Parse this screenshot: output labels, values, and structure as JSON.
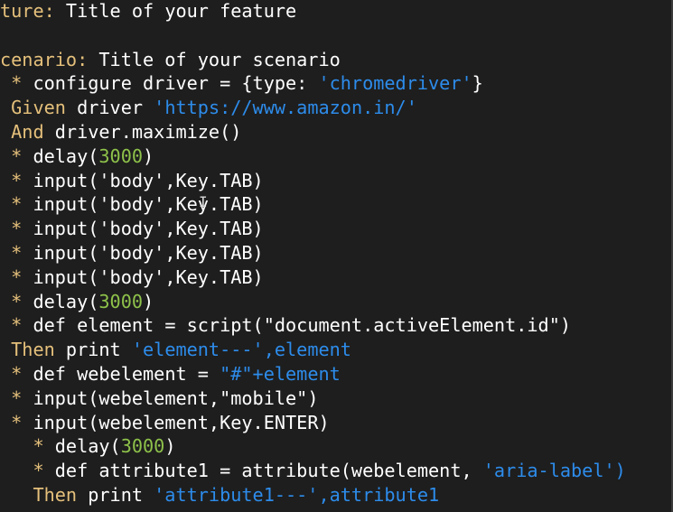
{
  "editor": {
    "lines": [
      {
        "id": "feature",
        "segs": [
          {
            "c": "kw",
            "t": "ture:"
          },
          {
            "c": "plain",
            "t": " Title of your feature"
          }
        ]
      },
      {
        "id": "blank",
        "segs": []
      },
      {
        "id": "scenario",
        "segs": [
          {
            "c": "kw",
            "t": "cenario:"
          },
          {
            "c": "plain",
            "t": " Title of your scenario"
          }
        ]
      },
      {
        "id": "configure",
        "segs": [
          {
            "c": "star",
            "t": " *"
          },
          {
            "c": "plain",
            "t": " configure driver = {type: "
          },
          {
            "c": "str",
            "t": "'chromedriver'"
          },
          {
            "c": "plain",
            "t": "}"
          }
        ]
      },
      {
        "id": "given",
        "segs": [
          {
            "c": "kw",
            "t": " Given"
          },
          {
            "c": "plain",
            "t": " driver "
          },
          {
            "c": "str",
            "t": "'https://www.amazon.in/'"
          }
        ]
      },
      {
        "id": "and",
        "segs": [
          {
            "c": "kw",
            "t": " And"
          },
          {
            "c": "plain",
            "t": " driver.maximize()"
          }
        ]
      },
      {
        "id": "delay1",
        "segs": [
          {
            "c": "star",
            "t": " *"
          },
          {
            "c": "plain",
            "t": " delay("
          },
          {
            "c": "num",
            "t": "3000"
          },
          {
            "c": "plain",
            "t": ")"
          }
        ]
      },
      {
        "id": "input1",
        "segs": [
          {
            "c": "star",
            "t": " *"
          },
          {
            "c": "plain",
            "t": " input('body',Key.TAB)"
          }
        ]
      },
      {
        "id": "input2",
        "segs": [
          {
            "c": "star",
            "t": " *"
          },
          {
            "c": "plain",
            "t": " input('body',Key.TAB)"
          }
        ]
      },
      {
        "id": "input3",
        "segs": [
          {
            "c": "star",
            "t": " *"
          },
          {
            "c": "plain",
            "t": " input('body',Key.TAB)"
          }
        ]
      },
      {
        "id": "input4",
        "segs": [
          {
            "c": "star",
            "t": " *"
          },
          {
            "c": "plain",
            "t": " input('body',Key.TAB)"
          }
        ]
      },
      {
        "id": "input5",
        "segs": [
          {
            "c": "star",
            "t": " *"
          },
          {
            "c": "plain",
            "t": " input('body',Key.TAB)"
          }
        ]
      },
      {
        "id": "delay2",
        "segs": [
          {
            "c": "star",
            "t": " *"
          },
          {
            "c": "plain",
            "t": " delay("
          },
          {
            "c": "num",
            "t": "3000"
          },
          {
            "c": "plain",
            "t": ")"
          }
        ]
      },
      {
        "id": "def-element",
        "segs": [
          {
            "c": "star",
            "t": " *"
          },
          {
            "c": "plain",
            "t": " def element = script(\"document.activeElement.id\")"
          }
        ]
      },
      {
        "id": "then1",
        "segs": [
          {
            "c": "kw",
            "t": " Then"
          },
          {
            "c": "plain",
            "t": " print "
          },
          {
            "c": "str",
            "t": "'element---',element"
          }
        ]
      },
      {
        "id": "def-webelement",
        "segs": [
          {
            "c": "star",
            "t": " *"
          },
          {
            "c": "plain",
            "t": " def webelement = "
          },
          {
            "c": "str",
            "t": "\"#\"+element"
          }
        ]
      },
      {
        "id": "input-mobile",
        "segs": [
          {
            "c": "star",
            "t": " *"
          },
          {
            "c": "plain",
            "t": " input(webelement,\"mobile\")"
          }
        ]
      },
      {
        "id": "input-enter",
        "segs": [
          {
            "c": "star",
            "t": " *"
          },
          {
            "c": "plain",
            "t": " input(webelement,Key.ENTER)"
          }
        ]
      },
      {
        "id": "delay3",
        "segs": [
          {
            "c": "star",
            "t": "   *"
          },
          {
            "c": "plain",
            "t": " delay("
          },
          {
            "c": "num",
            "t": "3000"
          },
          {
            "c": "plain",
            "t": ")"
          }
        ]
      },
      {
        "id": "def-attribute",
        "segs": [
          {
            "c": "star",
            "t": "   *"
          },
          {
            "c": "plain",
            "t": " def attribute1 = attribute(webelement, "
          },
          {
            "c": "str",
            "t": "'aria-label')"
          }
        ]
      },
      {
        "id": "then2",
        "segs": [
          {
            "c": "kw",
            "t": "   Then"
          },
          {
            "c": "plain",
            "t": " print "
          },
          {
            "c": "str",
            "t": "'attribute1---',attribute1"
          }
        ]
      }
    ]
  },
  "colors": {
    "background": "#1e1e1e",
    "keyword": "#e5c07b",
    "string": "#2d8ceb",
    "number": "#8ec24a",
    "text": "#ffffff"
  },
  "cursor_icon": "text-cursor-icon",
  "cursor_glyph": "I"
}
